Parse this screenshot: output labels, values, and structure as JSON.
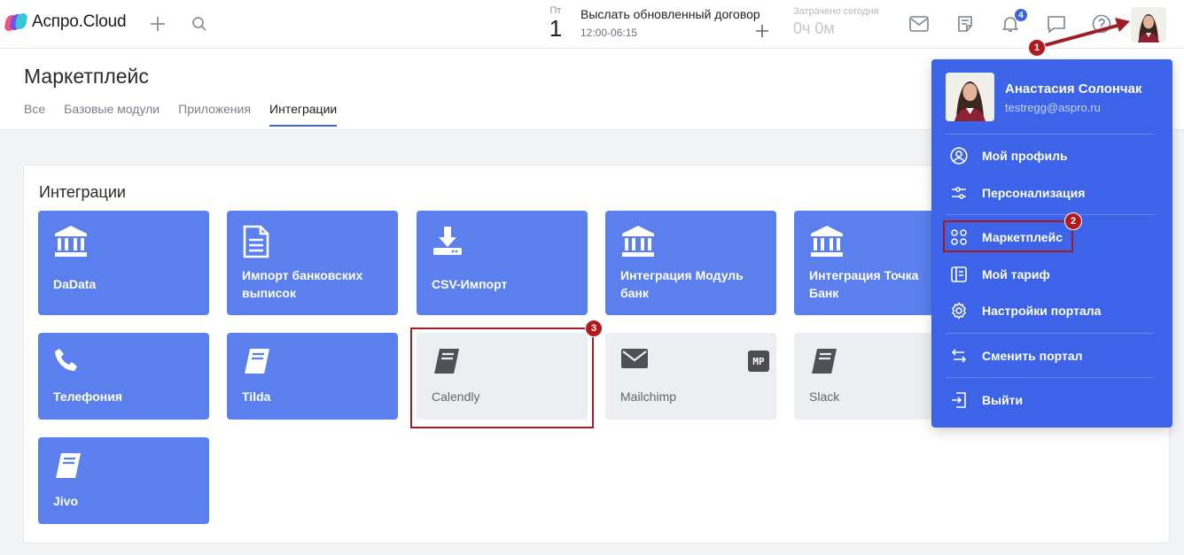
{
  "app": {
    "name": "Аспро.Cloud"
  },
  "topbar": {
    "day_of_week": "Пт",
    "day_number": "1",
    "task_title": "Выслать обновленный договор",
    "task_time": "12:00-06:15",
    "spent_label": "Затрачено сегодня",
    "spent_value": "0ч 0м",
    "notifications_count": "4"
  },
  "page": {
    "title": "Маркетплейс",
    "tabs": [
      {
        "label": "Все",
        "active": false
      },
      {
        "label": "Базовые модули",
        "active": false
      },
      {
        "label": "Приложения",
        "active": false
      },
      {
        "label": "Интеграции",
        "active": true
      }
    ]
  },
  "section": {
    "title": "Интеграции",
    "tiles": [
      {
        "label": "DaData",
        "icon": "bank-icon",
        "enabled": true
      },
      {
        "label": "Импорт банковских выписок",
        "icon": "document-icon",
        "enabled": true
      },
      {
        "label": "CSV-Импорт",
        "icon": "download-icon",
        "enabled": true
      },
      {
        "label": "Интеграция Модуль банк",
        "icon": "bank-icon",
        "enabled": true
      },
      {
        "label": "Интеграция Точка Банк",
        "icon": "bank-icon",
        "enabled": true
      },
      {
        "label": "Телефония",
        "icon": "phone-icon",
        "enabled": true
      },
      {
        "label": "Tilda",
        "icon": "book-icon",
        "enabled": true
      },
      {
        "label": "Calendly",
        "icon": "book-icon",
        "enabled": false
      },
      {
        "label": "Mailchimp",
        "icon": "mail-icon",
        "enabled": false,
        "badge": "MP"
      },
      {
        "label": "Slack",
        "icon": "book-icon",
        "enabled": false
      },
      {
        "label": "Jivo",
        "icon": "book-icon",
        "enabled": true
      }
    ]
  },
  "user_menu": {
    "name": "Анастасия Солончак",
    "email": "testregg@aspro.ru",
    "items": [
      {
        "label": "Мой профиль",
        "icon": "user-circle-icon"
      },
      {
        "label": "Персонализация",
        "icon": "sliders-icon"
      },
      {
        "label": "Маркетплейс",
        "icon": "grid-circles-icon"
      },
      {
        "label": "Мой тариф",
        "icon": "tariff-icon"
      },
      {
        "label": "Настройки портала",
        "icon": "gear-icon"
      },
      {
        "label": "Сменить портал",
        "icon": "swap-icon"
      },
      {
        "label": "Выйти",
        "icon": "logout-icon"
      }
    ]
  },
  "annotations": {
    "marker_1": "1",
    "marker_2": "2",
    "marker_3": "3"
  },
  "colors": {
    "accent": "#3d64e8",
    "tile": "#5b80ee",
    "tile_disabled": "#eceef1",
    "annotation": "#b21a1f"
  }
}
